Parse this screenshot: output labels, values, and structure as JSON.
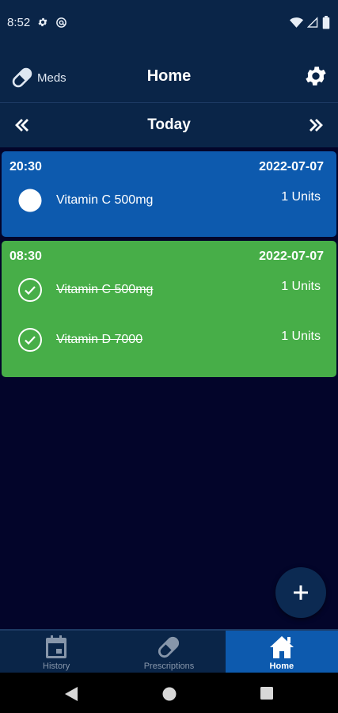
{
  "status_bar": {
    "time": "8:52",
    "icons": [
      "gear-icon",
      "at-sign-icon",
      "wifi-icon",
      "signal-icon",
      "battery-icon"
    ]
  },
  "app_bar": {
    "meds_label": "Meds",
    "title": "Home",
    "settings_icon": "gear-icon"
  },
  "date_nav": {
    "label": "Today",
    "prev_icon": "double-chevron-left-icon",
    "next_icon": "double-chevron-right-icon"
  },
  "schedules": [
    {
      "time": "20:30",
      "date": "2022-07-07",
      "color": "#0d5aae",
      "items": [
        {
          "name": "Vitamin C 500mg",
          "units": "1 Units",
          "taken": false
        }
      ]
    },
    {
      "time": "08:30",
      "date": "2022-07-07",
      "color": "#47ae48",
      "items": [
        {
          "name": "Vitamin C 500mg",
          "units": "1 Units",
          "taken": true
        },
        {
          "name": "Vitamin D 7000",
          "units": "1 Units",
          "taken": true
        }
      ]
    }
  ],
  "fab": {
    "icon": "plus-icon"
  },
  "bottom_nav": {
    "items": [
      {
        "label": "History",
        "icon": "calendar-icon",
        "active": false
      },
      {
        "label": "Prescriptions",
        "icon": "pill-icon",
        "active": false
      },
      {
        "label": "Home",
        "icon": "home-icon",
        "active": true
      }
    ]
  },
  "system_nav": [
    "back-icon",
    "home-circle-icon",
    "recents-icon"
  ],
  "colors": {
    "app_bar": "#0a2548",
    "background": "#03052a",
    "upcoming": "#0d5aae",
    "taken": "#47ae48",
    "active_tab": "#0d5aae"
  }
}
